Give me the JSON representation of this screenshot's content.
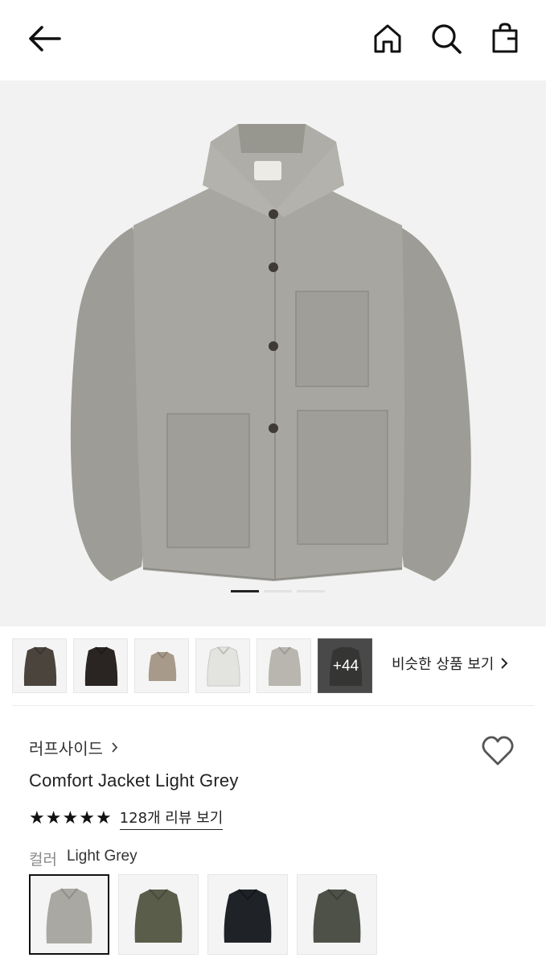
{
  "header": {
    "back_icon": "arrow-left-icon",
    "home_icon": "home-icon",
    "search_icon": "search-icon",
    "bag_icon": "shopping-bag-icon"
  },
  "gallery": {
    "image_count_indicator": {
      "active_index": 1,
      "total": 3
    },
    "jacket_color": "#a7a6a0"
  },
  "thumbnails": {
    "items": [
      {
        "color": "#4a443d"
      },
      {
        "color": "#2a2522"
      },
      {
        "color": "#a79a8a"
      },
      {
        "color": "#e3e3e0"
      },
      {
        "color": "#b8b6ae"
      },
      {
        "color": "#2d2d2c"
      }
    ],
    "more_label": "+44",
    "similar_label": "비슷한 상품 보기"
  },
  "product": {
    "brand": "러프사이드",
    "title": "Comfort Jacket Light Grey",
    "rating": 5,
    "review_label": "128개 리뷰 보기",
    "color_key": "컬러",
    "color_value": "Light Grey",
    "favorite_icon": "heart-icon"
  },
  "swatches": [
    {
      "color": "#a9a8a2",
      "selected": true
    },
    {
      "color": "#5b5d4b",
      "selected": false
    },
    {
      "color": "#1f2227",
      "selected": false
    },
    {
      "color": "#4e5147",
      "selected": false
    }
  ]
}
